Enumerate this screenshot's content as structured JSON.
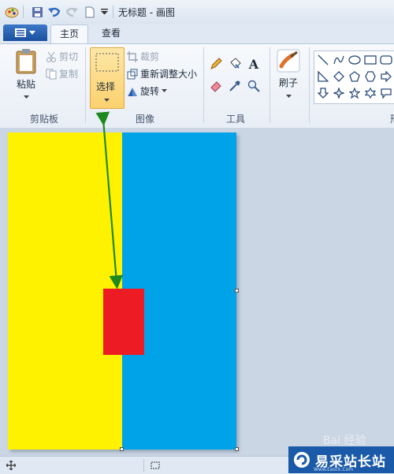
{
  "window": {
    "title": "无标题 - 画图"
  },
  "tabs": {
    "home": "主页",
    "view": "查看"
  },
  "clipboard": {
    "paste": "粘贴",
    "cut": "剪切",
    "copy": "复制",
    "group": "剪贴板"
  },
  "image": {
    "select": "选择",
    "crop": "裁剪",
    "resize": "重新调整大小",
    "rotate": "旋转",
    "group": "图像"
  },
  "tools": {
    "text_tool": "A",
    "group": "工具"
  },
  "brushes": {
    "label": "刷子"
  },
  "shapes": {
    "group_partial": "形"
  },
  "canvas": {
    "colors": {
      "left": "#fff200",
      "right": "#00a2e8",
      "rect": "#ed1c24"
    }
  },
  "annotation": {
    "arrow_color": "#1e8a1e"
  },
  "watermark": {
    "brand": "易采站长站",
    "sub": "Www.Easck.Com",
    "corner": "Bai 经验"
  },
  "accent": "#1a4fa0"
}
